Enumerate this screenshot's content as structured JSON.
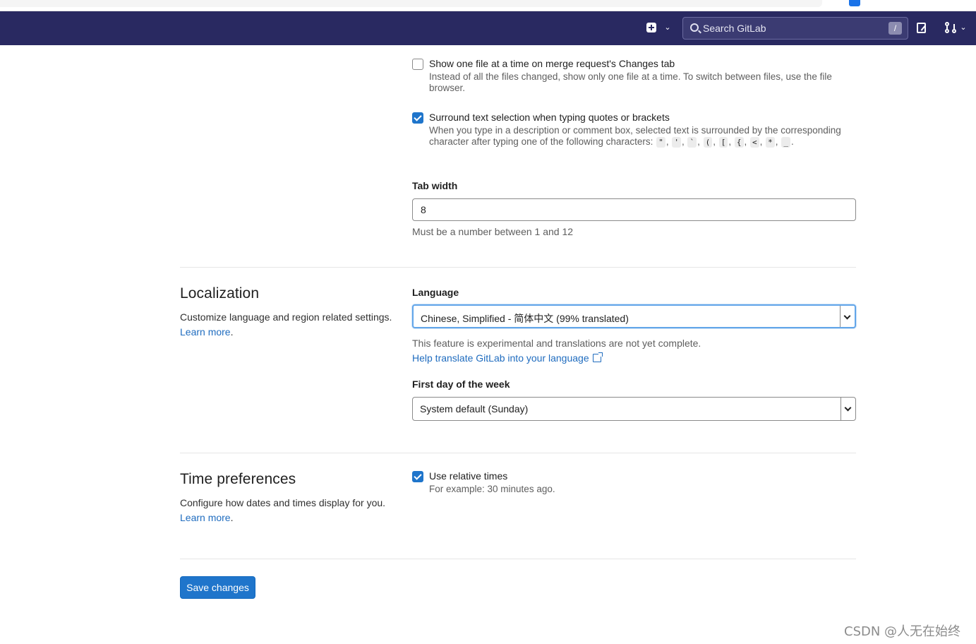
{
  "navbar": {
    "search_placeholder": "Search GitLab",
    "search_shortcut": "/",
    "plus_caret": "⌄",
    "mr_caret": "⌄"
  },
  "editor": {
    "single_file": {
      "label": "Show one file at a time on merge request's Changes tab",
      "help": "Instead of all the files changed, show only one file at a time. To switch between files, use the file browser.",
      "checked": false
    },
    "surround": {
      "label": "Surround text selection when typing quotes or brackets",
      "help_prefix": "When you type in a description or comment box, selected text is surrounded by the corresponding character after typing one of the following characters: ",
      "chars": [
        "\"",
        "'",
        "`",
        "(",
        "[",
        "{",
        "<",
        "*",
        "_"
      ],
      "help_suffix": ".",
      "checked": true
    },
    "tab_width": {
      "label": "Tab width",
      "value": "8",
      "help": "Must be a number between 1 and 12"
    }
  },
  "localization": {
    "title": "Localization",
    "description": "Customize language and region related settings.",
    "learn_more": "Learn more",
    "period": ".",
    "language_label": "Language",
    "language_value": "Chinese, Simplified - 简体中文 (99% translated)",
    "language_help": "This feature is experimental and translations are not yet complete.",
    "translate_link": "Help translate GitLab into your language",
    "first_day_label": "First day of the week",
    "first_day_value": "System default (Sunday)"
  },
  "time_preferences": {
    "title": "Time preferences",
    "description": "Configure how dates and times display for you.",
    "learn_more": "Learn more",
    "period": ".",
    "relative_label": "Use relative times",
    "relative_help": "For example: 30 minutes ago.",
    "relative_checked": true
  },
  "actions": {
    "save_label": "Save changes"
  },
  "watermark": "CSDN @人无在始终",
  "colors": {
    "navbar": "#292961",
    "primary": "#1f75cb",
    "link": "#1f6cbf"
  }
}
